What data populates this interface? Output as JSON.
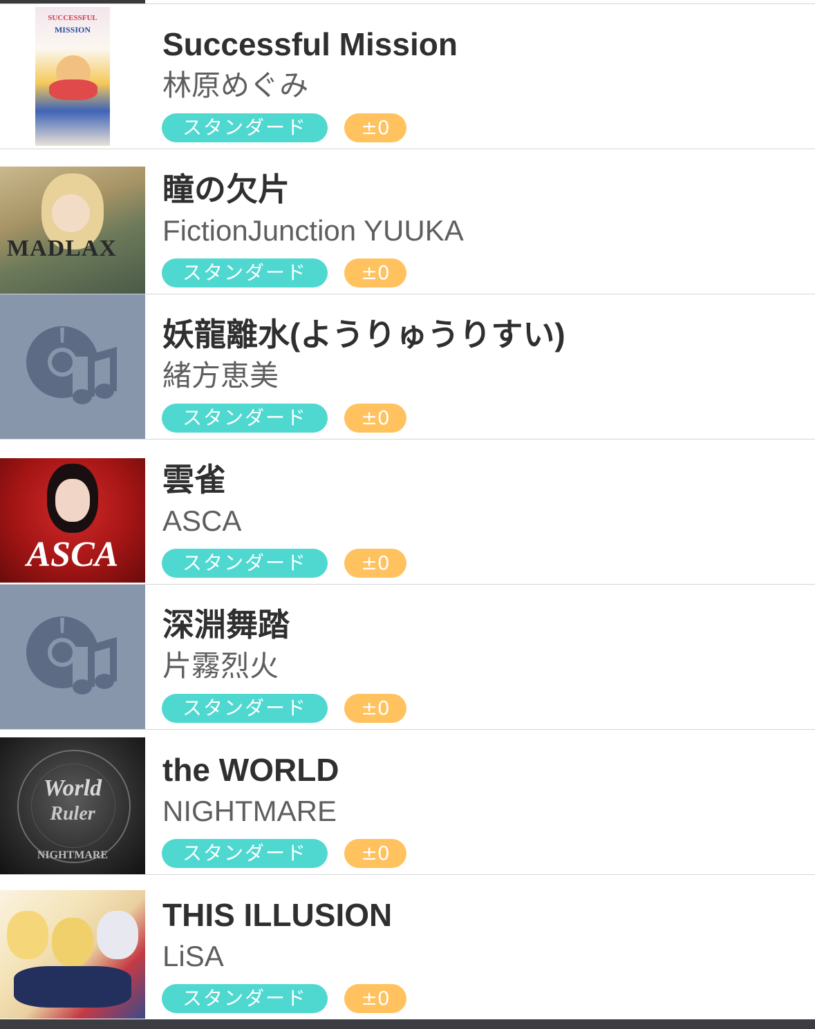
{
  "songs": [
    {
      "title": "Successful Mission",
      "artist": "林原めぐみ",
      "difficulty": "スタンダード",
      "delta": "±0",
      "jacket": "cover-successful-mission"
    },
    {
      "title": "瞳の欠片",
      "artist": "FictionJunction YUUKA",
      "difficulty": "スタンダード",
      "delta": "±0",
      "jacket": "cover-madlax"
    },
    {
      "title": "妖龍離水(ようりゅうりすい)",
      "artist": "緒方恵美",
      "difficulty": "スタンダード",
      "delta": "±0",
      "jacket": "placeholder-music-disc-icon"
    },
    {
      "title": "雲雀",
      "artist": "ASCA",
      "difficulty": "スタンダード",
      "delta": "±0",
      "jacket": "cover-asca"
    },
    {
      "title": "深淵舞踏",
      "artist": "片霧烈火",
      "difficulty": "スタンダード",
      "delta": "±0",
      "jacket": "placeholder-music-disc-icon"
    },
    {
      "title": "the WORLD",
      "artist": "NIGHTMARE",
      "difficulty": "スタンダード",
      "delta": "±0",
      "jacket": "cover-the-world-ruler"
    },
    {
      "title": "THIS ILLUSION",
      "artist": "LiSA",
      "difficulty": "スタンダード",
      "delta": "±0",
      "jacket": "cover-this-illusion"
    }
  ],
  "colors": {
    "difficulty_badge": "#4fd8d0",
    "delta_badge": "#ffc25e",
    "placeholder_bg": "#8896ac",
    "placeholder_icon": "#5d6b84",
    "title_text": "#2f2f2f",
    "artist_text": "#5e5e5e",
    "divider": "#d4d4d4"
  }
}
